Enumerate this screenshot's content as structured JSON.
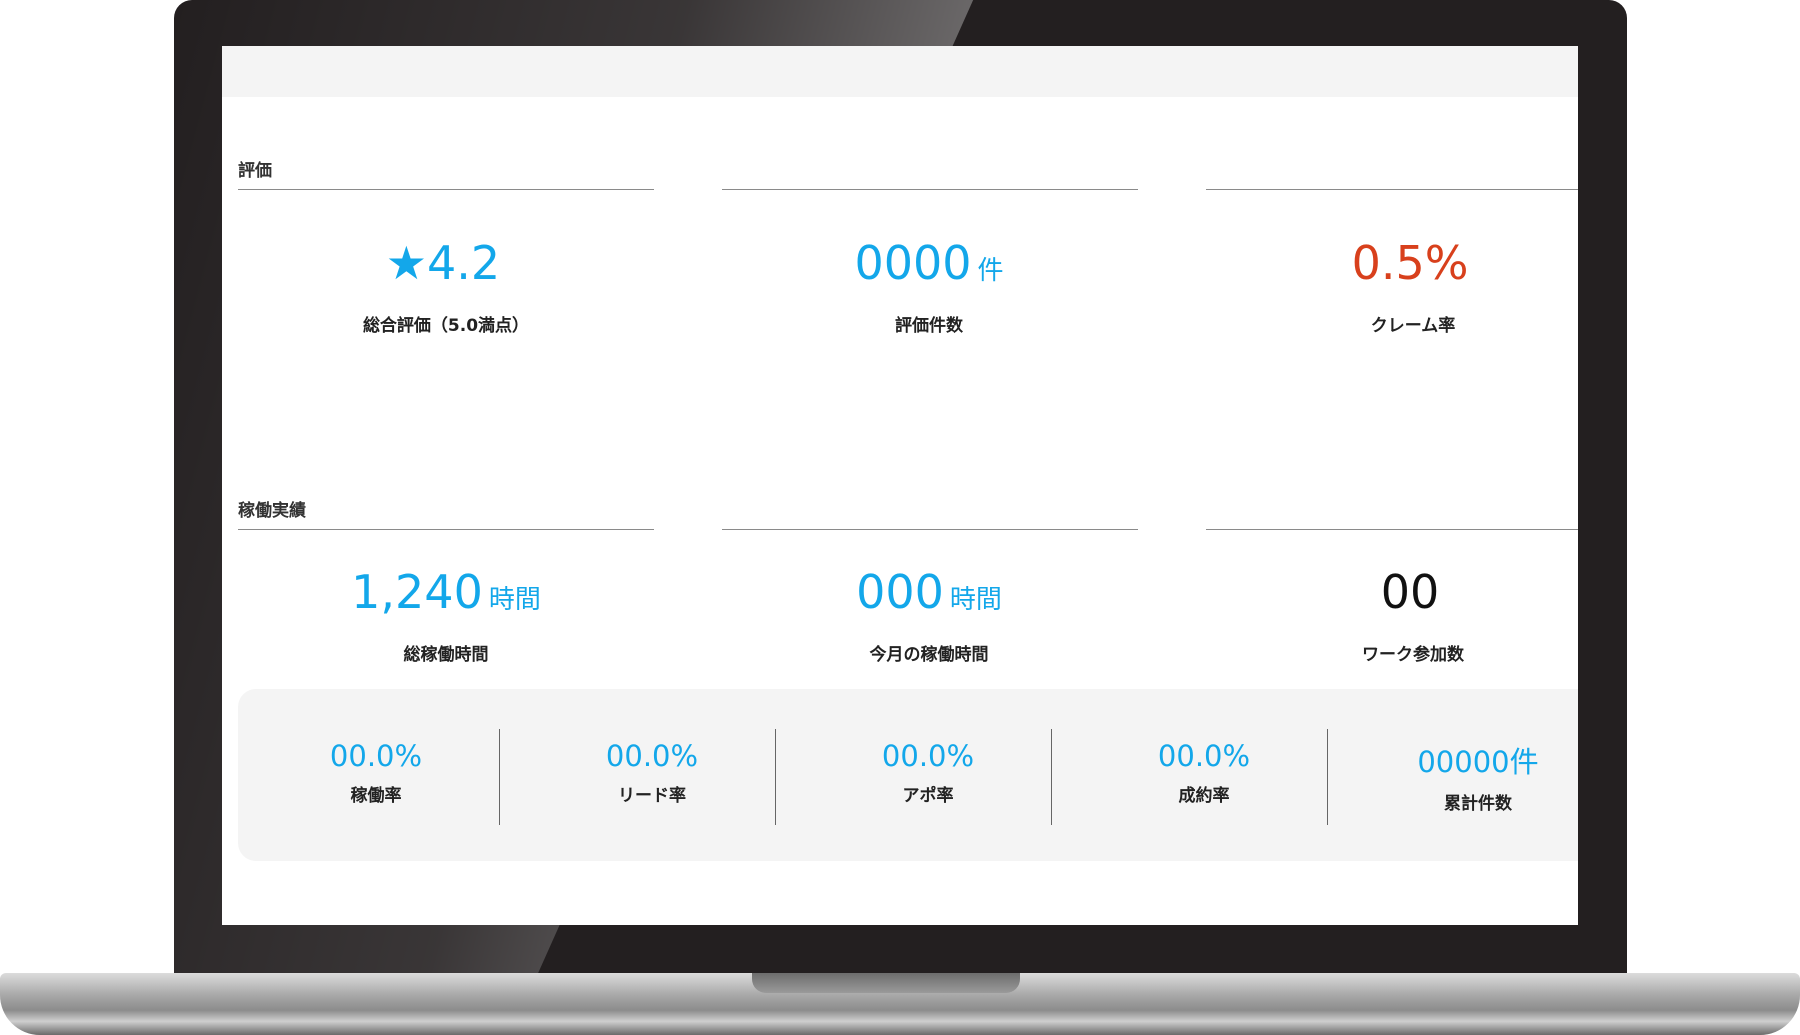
{
  "evaluation": {
    "section_title": "評価",
    "stats": [
      {
        "value": "★4.2",
        "unit": "",
        "label": "総合評価（5.0満点）"
      },
      {
        "value": "0000",
        "unit": "件",
        "label": "評価件数"
      },
      {
        "value": "0.5%",
        "unit": "",
        "label": "クレーム率"
      }
    ]
  },
  "operations": {
    "section_title": "稼働実績",
    "stats": [
      {
        "value": "1,240",
        "unit": "時間",
        "label": "総稼働時間"
      },
      {
        "value": "000",
        "unit": "時間",
        "label": "今月の稼働時間"
      },
      {
        "value": "00",
        "unit": "",
        "label": "ワーク参加数"
      }
    ]
  },
  "kpis": [
    {
      "value": "00.0%",
      "label": "稼働率"
    },
    {
      "value": "00.0%",
      "label": "リード率"
    },
    {
      "value": "00.0%",
      "label": "アポ率"
    },
    {
      "value": "00.0%",
      "label": "成約率"
    },
    {
      "value": "00000件",
      "label": "累計件数"
    }
  ],
  "colors": {
    "accent_blue": "#13a7ea",
    "alert_red": "#d8401c"
  }
}
